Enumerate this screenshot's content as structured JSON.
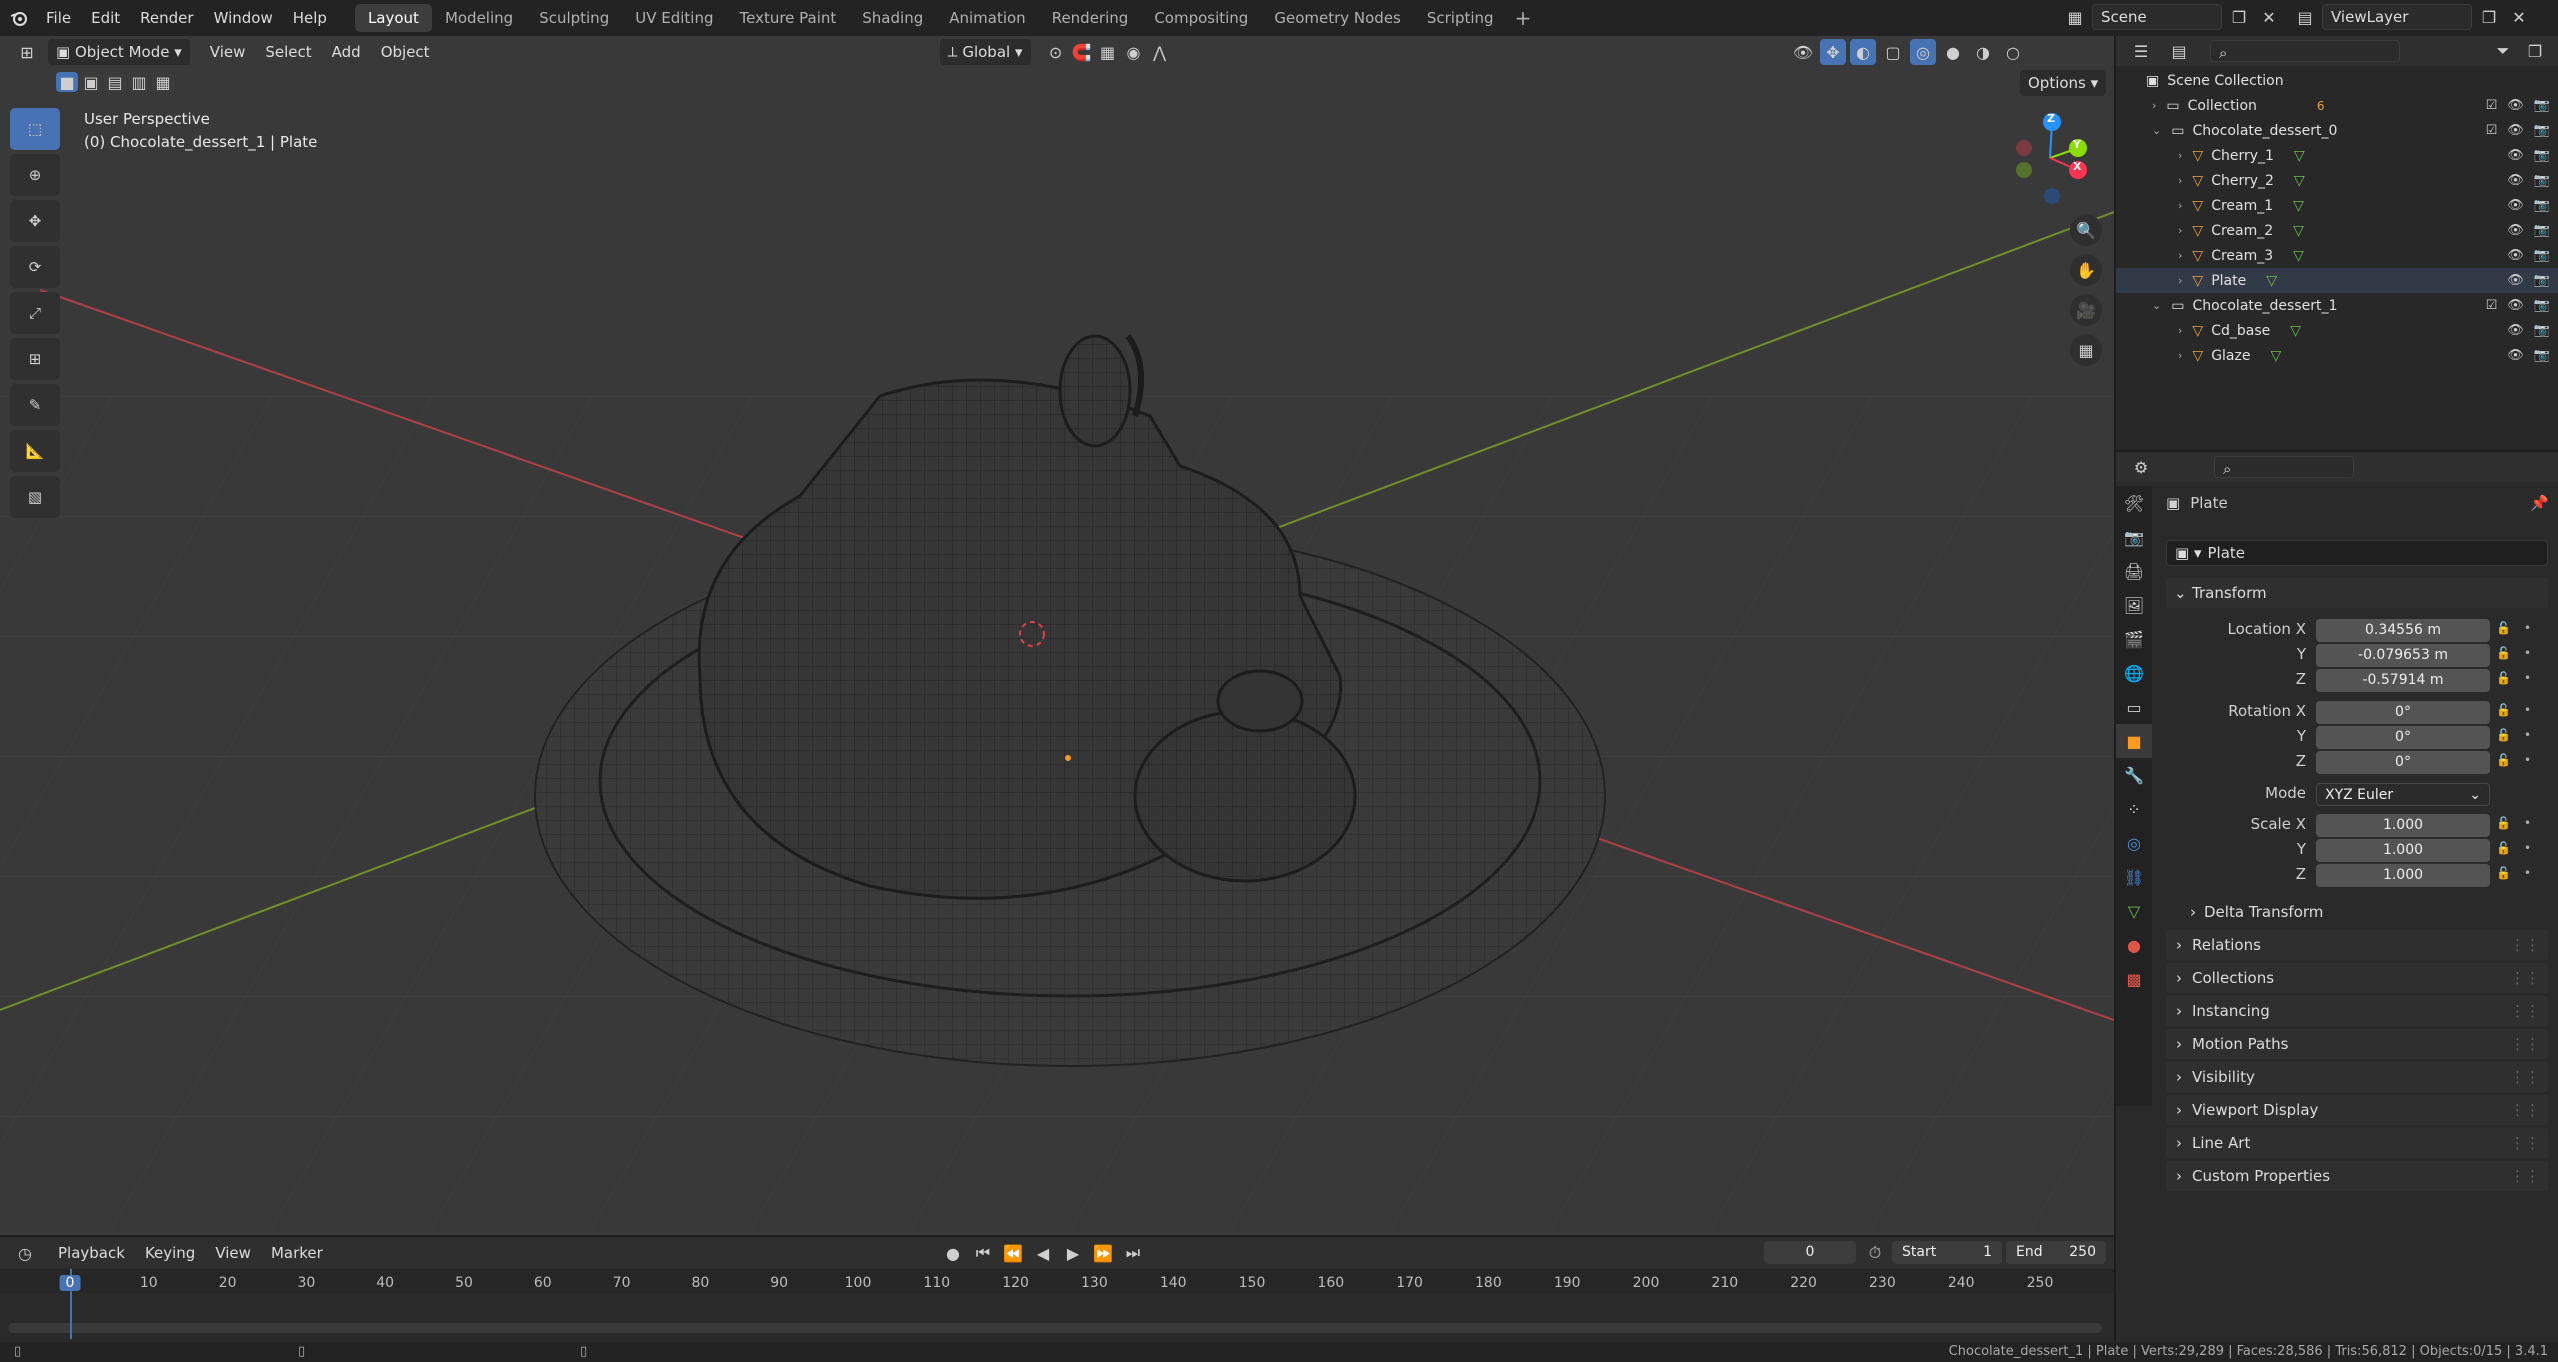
{
  "app": {
    "logo": "blender-logo-icon"
  },
  "topbar": {
    "menus": [
      "File",
      "Edit",
      "Render",
      "Window",
      "Help"
    ],
    "workspaces": [
      "Layout",
      "Modeling",
      "Sculpting",
      "UV Editing",
      "Texture Paint",
      "Shading",
      "Animation",
      "Rendering",
      "Compositing",
      "Geometry Nodes",
      "Scripting"
    ],
    "active_workspace": "Layout",
    "scene": "Scene",
    "view_layer": "ViewLayer"
  },
  "viewport": {
    "mode": "Object Mode",
    "menus": [
      "View",
      "Select",
      "Add",
      "Object"
    ],
    "transform_orientation": "Global",
    "options_label": "Options",
    "overlay_title": "User Perspective",
    "overlay_subtitle": "(0) Chocolate_dessert_1 | Plate",
    "gizmo_axes": {
      "x": "X",
      "y": "Y",
      "z": "Z"
    },
    "axis_colors": {
      "x": "#ff3352",
      "y": "#8bdc00",
      "z": "#2890ff"
    }
  },
  "outliner": {
    "root": "Scene Collection",
    "rows": [
      {
        "label": "Collection",
        "level": 0
      },
      {
        "label": "Chocolate_dessert_0",
        "level": 0
      },
      {
        "label": "Cherry_1",
        "level": 1
      },
      {
        "label": "Cherry_2",
        "level": 1
      },
      {
        "label": "Cream_1",
        "level": 1
      },
      {
        "label": "Cream_2",
        "level": 1
      },
      {
        "label": "Cream_3",
        "level": 1
      },
      {
        "label": "Plate",
        "level": 1
      },
      {
        "label": "Chocolate_dessert_1",
        "level": 0
      },
      {
        "label": "Cd_base",
        "level": 1
      },
      {
        "label": "Glaze",
        "level": 1
      }
    ],
    "collection_badge": "6"
  },
  "properties": {
    "object_name": "Plate",
    "datablock_name": "Plate",
    "transform_label": "Transform",
    "location": {
      "label": "Location X",
      "x": "0.34556 m",
      "y": "-0.079653 m",
      "z": "-0.57914 m"
    },
    "rotation": {
      "label": "Rotation X",
      "x": "0°",
      "y": "0°",
      "z": "0°"
    },
    "mode_label": "Mode",
    "mode_value": "XYZ Euler",
    "scale": {
      "label": "Scale X",
      "x": "1.000",
      "y": "1.000",
      "z": "1.000"
    },
    "axis_y": "Y",
    "axis_z": "Z",
    "delta_transform": "Delta Transform",
    "panels": [
      "Relations",
      "Collections",
      "Instancing",
      "Motion Paths",
      "Visibility",
      "Viewport Display",
      "Line Art",
      "Custom Properties"
    ]
  },
  "timeline": {
    "menus": [
      "Playback",
      "Keying",
      "View",
      "Marker"
    ],
    "current_frame": "0",
    "start_label": "Start",
    "start": "1",
    "end_label": "End",
    "end": "250",
    "ruler": [
      "0",
      "10",
      "20",
      "30",
      "40",
      "50",
      "60",
      "70",
      "80",
      "90",
      "100",
      "110",
      "120",
      "130",
      "140",
      "150",
      "160",
      "170",
      "180",
      "190",
      "200",
      "210",
      "220",
      "230",
      "240",
      "250"
    ]
  },
  "statusbar": {
    "text": "Chocolate_dessert_1 | Plate | Verts:29,289 | Faces:28,586 | Tris:56,812 | Objects:0/15 | 3.4.1"
  }
}
